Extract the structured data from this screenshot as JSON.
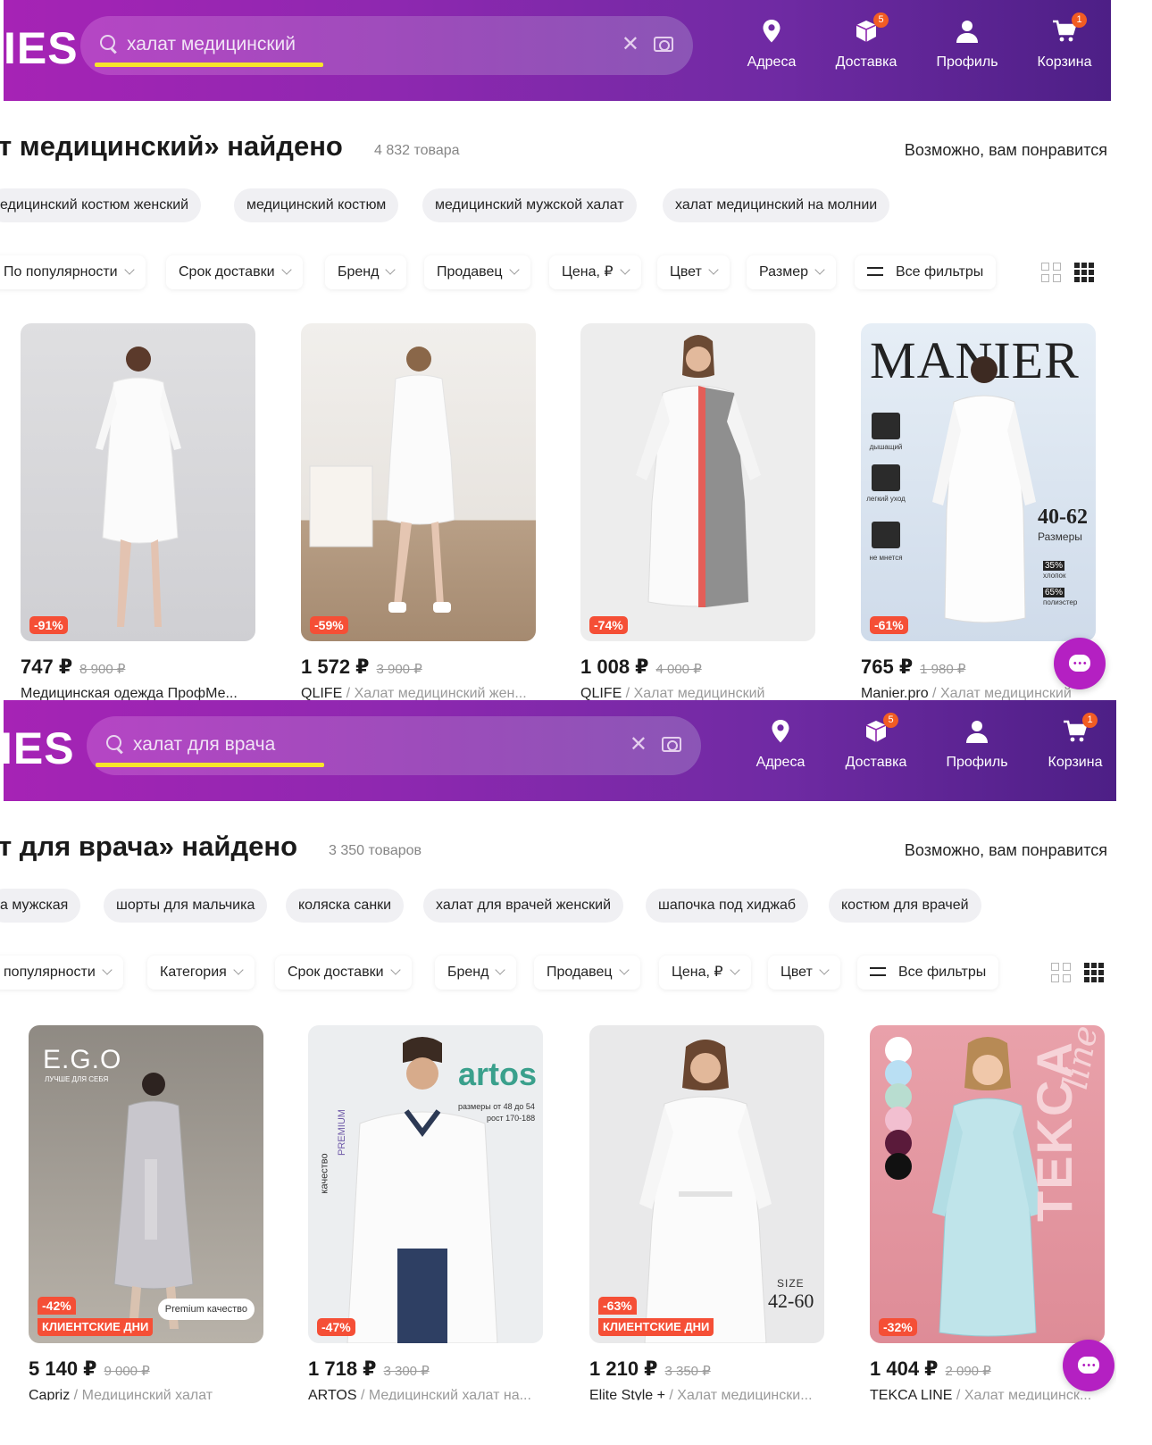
{
  "panels": [
    {
      "logo": "IES",
      "search": {
        "value": "халат медицинский"
      },
      "nav": [
        {
          "label": "Адреса",
          "icon": "map-pin-icon"
        },
        {
          "label": "Доставка",
          "icon": "box-icon",
          "badge": "5"
        },
        {
          "label": "Профиль",
          "icon": "user-icon"
        },
        {
          "label": "Корзина",
          "icon": "cart-icon",
          "badge": "1"
        }
      ],
      "title": "т медицинский» найдено",
      "count": "4 832 товара",
      "maybe_like": "Возможно, вам понравится",
      "chips": [
        "едицинский костюм женский",
        "медицинский костюм",
        "медицинский мужской халат",
        "халат медицинский на молнии"
      ],
      "filters": [
        "По популярности",
        "Срок доставки",
        "Бренд",
        "Продавец",
        "Цена, ₽",
        "Цвет",
        "Размер"
      ],
      "all_filters": "Все фильтры",
      "products": [
        {
          "discount": "-91%",
          "price": "747 ₽",
          "old_price": "8 900 ₽",
          "brand": "Медицинская одежда ПрофМе...",
          "name": ""
        },
        {
          "discount": "-59%",
          "price": "1 572 ₽",
          "old_price": "3 900 ₽",
          "brand": "QLIFE",
          "name": "Халат медицинский жен..."
        },
        {
          "discount": "-74%",
          "price": "1 008 ₽",
          "old_price": "4 000 ₽",
          "brand": "QLIFE",
          "name": "Халат медицинский"
        },
        {
          "discount": "-61%",
          "price": "765 ₽",
          "old_price": "1 980 ₽",
          "brand": "Manier.pro",
          "name": "Халат медицинский",
          "image_text": {
            "brand": "MANIER",
            "size": "40-62",
            "size_label": "Размеры",
            "f1": "дышащий",
            "f2": "легкий уход",
            "f3": "не мнется",
            "c1": "35%",
            "c1l": "хлопок",
            "c2": "65%",
            "c2l": "полиэстер"
          }
        }
      ]
    },
    {
      "logo": "IES",
      "search": {
        "value": "халат для врача"
      },
      "nav": [
        {
          "label": "Адреса",
          "icon": "map-pin-icon"
        },
        {
          "label": "Доставка",
          "icon": "box-icon",
          "badge": "5"
        },
        {
          "label": "Профиль",
          "icon": "user-icon"
        },
        {
          "label": "Корзина",
          "icon": "cart-icon",
          "badge": "1"
        }
      ],
      "title": "т для врача» найдено",
      "count": "3 350 товаров",
      "maybe_like": "Возможно, вам понравится",
      "chips": [
        "а мужская",
        "шорты для мальчика",
        "коляска санки",
        "халат для врачей женский",
        "шапочка под хиджаб",
        "костюм для врачей"
      ],
      "filters": [
        "популярности",
        "Категория",
        "Срок доставки",
        "Бренд",
        "Продавец",
        "Цена, ₽",
        "Цвет"
      ],
      "all_filters": "Все фильтры",
      "products": [
        {
          "discount": "-42%",
          "promo": "КЛИЕНТСКИЕ ДНИ",
          "price": "5 140 ₽",
          "old_price": "9 000 ₽",
          "brand": "Capriz",
          "name": "Медицинский халат",
          "image_text": {
            "brand": "E.G.O",
            "tagline": "ЛУЧШЕ ДЛЯ СЕБЯ",
            "badge": "Premium качество"
          }
        },
        {
          "discount": "-47%",
          "price": "1 718 ₽",
          "old_price": "3 300 ₽",
          "brand": "ARTOS",
          "name": "Медицинский халат на...",
          "image_text": {
            "brand": "artos",
            "sizes": "размеры от 48 до 54",
            "height": "рост 170-188",
            "side1": "качество",
            "side2": "PREMIUM"
          }
        },
        {
          "discount": "-63%",
          "promo": "КЛИЕНТСКИЕ ДНИ",
          "price": "1 210 ₽",
          "old_price": "3 350 ₽",
          "brand": "Elite Style +",
          "name": "Халат медицински...",
          "image_text": {
            "size_label": "SIZE",
            "size": "42-60"
          }
        },
        {
          "discount": "-32%",
          "price": "1 404 ₽",
          "old_price": "2 090 ₽",
          "brand": "TEKCA LINE",
          "name": "Халат медицинск...",
          "image_text": {
            "brand": "TEKCA",
            "script": "line"
          }
        }
      ]
    }
  ],
  "colors": {
    "header_start": "#a623b5",
    "header_end": "#4d1f86",
    "discount": "#f54f36",
    "search_underline": "#f7e52a",
    "chat": "#b420c2"
  }
}
